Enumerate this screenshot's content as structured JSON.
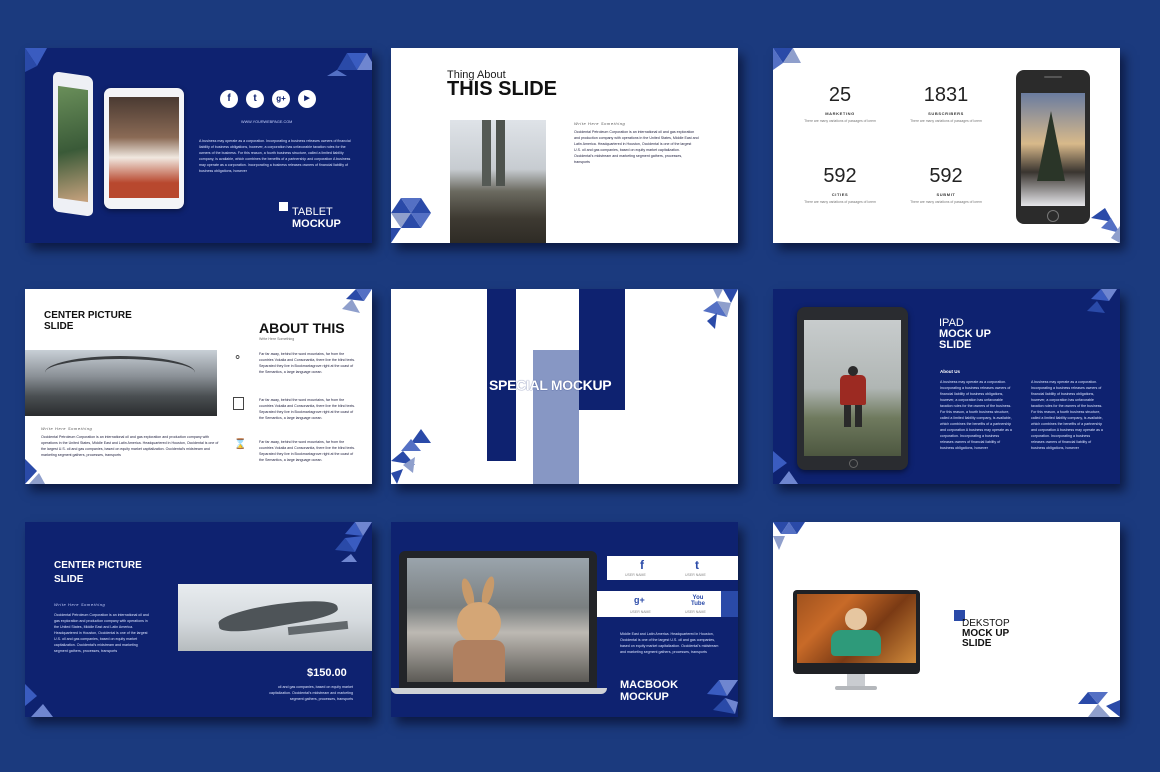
{
  "colors": {
    "background": "#1b3a7e",
    "navy": "#0e2270",
    "accent": "#2a4aa8",
    "pale_accent": "#8f9fcc"
  },
  "slide1": {
    "url": "WWW.YOURWEBPAGE.COM",
    "title1": "TABLET",
    "title2": "MOCKUP",
    "body": "A business may operate as a corporation. Incorporating a business releases owners of financial liability of business obligations, however, a corporation has unfavorable taxation rules for the owners of the business. For this reason, a fourth business structure, called a limited liability company, is available, which combines the benefits of a partnership and corporation A business may operate as a corporation. Incorporating a business releases owners of financial liability of business obligations, however"
  },
  "slide2": {
    "kicker": "Thing About",
    "title": "THIS SLIDE",
    "subtitle": "Write Here Something",
    "body": "Occidental Petroleum Corporation is an international oil and gas exploration and production company with operations in the United States, Middle East and Latin America. Headquartered in Houston, Occidental is one of the largest U.S. oil and gas companies, based on equity market capitalization. Occidental's midstream and marketing segment gathers, processes, transports"
  },
  "slide3": {
    "stats": [
      {
        "num": "25",
        "label": "MARKETING",
        "desc": "There are many variations of passages of lorem"
      },
      {
        "num": "1831",
        "label": "SUBSCRIBERS",
        "desc": "There are many variations of passages of lorem"
      },
      {
        "num": "592",
        "label": "CITIES",
        "desc": "There are many variations of passages of lorem"
      },
      {
        "num": "592",
        "label": "SUBMIT",
        "desc": "There are many variations of passages of lorem"
      }
    ]
  },
  "slide4": {
    "title1": "CENTER PICTURE",
    "title2": "SLIDE",
    "heading": "ABOUT THIS",
    "heading_sub": "Write Here Something",
    "subtitle": "Write Here Something",
    "body": "Occidental Petroleum Corporation is an international oil and gas exploration and production company with operations in the United States, Middle East and Latin America. Headquartered in Houston, Occidental is one of the largest U.S. oil and gas companies, based on equity market capitalization. Occidental's midstream and marketing segment gathers, processes, transports",
    "items": [
      "Far far away, behind the word mountains, far from the countries Vokalia and Consonantia, there live the blind texts. Separated they live in Bookmarksgrove right at the coast of the Semantics, a large language ocean.",
      "Far far away, behind the word mountains, far from the countries Vokalia and Consonantia, there live the blind texts. Separated they live in Bookmarksgrove right at the coast of the Semantics, a large language ocean.",
      "Far far away, behind the word mountains, far from the countries Vokalia and Consonantia, there live the blind texts. Separated they live in Bookmarksgrove right at the coast of the Semantics, a large language ocean."
    ]
  },
  "slide5": {
    "title": "SPECIAL MOCKUP"
  },
  "slide6": {
    "title1": "IPAD",
    "title2": "MOCK UP",
    "title3": "SLIDE",
    "about": "About Us",
    "col1": "A business may operate as a corporation. Incorporating a business releases owners of financial liability of business obligations, however, a corporation has unfavorable taxation rules for the owners of the business. For this reason, a fourth business structure, called a limited liability company, is available, which combines the benefits of a partnership and corporation A business may operate as a corporation. Incorporating a business releases owners of financial liability of business obligations, however",
    "col2": "A business may operate as a corporation. Incorporating a business releases owners of financial liability of business obligations, however, a corporation has unfavorable taxation rules for the owners of the business. For this reason, a fourth business structure, called a limited liability company, is available, which combines the benefits of a partnership and corporation A business may operate as a corporation. Incorporating a business releases owners of financial liability of business obligations, however"
  },
  "slide7": {
    "title1": "CENTER PICTURE",
    "title2": "SLIDE",
    "subtitle": "Write Here Something",
    "body": "Occidental Petroleum Corporation is an international oil and gas exploration and production company with operations in the United States, Middle East and Latin America. Headquartered in Houston, Occidental is one of the largest U.S. oil and gas companies, based on equity market capitalization. Occidental's midstream and marketing segment gathers, processes, transports",
    "price": "$150.00",
    "price_note": "oil and gas companies, based on equity market capitalization. Occidental's midstream and marketing segment gathers, processes, transports"
  },
  "slide8": {
    "social": [
      {
        "glyph": "f",
        "name": "USER NAME"
      },
      {
        "glyph": "t",
        "name": "USER NAME"
      },
      {
        "glyph": "g+",
        "name": "USER NAME"
      },
      {
        "glyph": "You Tube",
        "name": "USER NAME"
      }
    ],
    "body": "Middle East and Latin America. Headquartered in Houston, Occidental is one of the largest U.S. oil and gas companies, based on equity market capitalization. Occidental's midstream and marketing segment gathers, processes, transports",
    "title1": "MACBOOK",
    "title2": "MOCKUP"
  },
  "slide9": {
    "title1": "DEKSTOP",
    "title2": "MOCK UP",
    "title3": "SLIDE"
  },
  "slide1_icons": [
    "facebook-icon",
    "twitter-icon",
    "google-plus-icon",
    "youtube-icon"
  ],
  "slide1_icon_glyphs": [
    "f",
    "t",
    "g+",
    "▶"
  ]
}
